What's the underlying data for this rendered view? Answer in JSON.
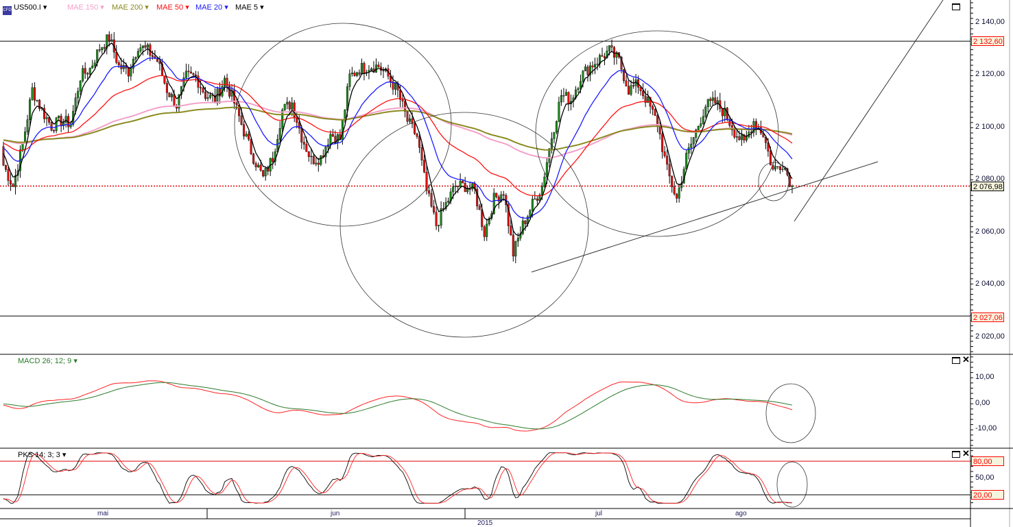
{
  "legend": {
    "symbol": "US500.I",
    "items": [
      {
        "label": "MAE 150",
        "color": "#f4a0c8"
      },
      {
        "label": "MAE 200",
        "color": "#8a8a20"
      },
      {
        "label": "MAE 50",
        "color": "#ff1010"
      },
      {
        "label": "MAE 20",
        "color": "#1a1aff"
      },
      {
        "label": "MAE 5",
        "color": "#000000"
      }
    ]
  },
  "price_axis": {
    "ticks": [
      "2 140,00",
      "2 120,00",
      "2 100,00",
      "2 080,00",
      "2 060,00",
      "2 040,00",
      "2 020,00"
    ],
    "tags": {
      "upper": "2 132,60",
      "last": "2 076,98",
      "lower": "2 027,06"
    }
  },
  "macd": {
    "label": "MACD 26; 12; 9",
    "ticks": [
      "10,00",
      "0,00",
      "-10,00"
    ]
  },
  "pks": {
    "label": "PKS 14; 3; 3",
    "ticks": [
      "80,00",
      "50,00",
      "20,00"
    ]
  },
  "time_axis": {
    "months": [
      "mai",
      "jun",
      "jul",
      "ago"
    ],
    "year": "2015"
  },
  "chart_data": {
    "type": "candlestick",
    "title": "US500.I",
    "ylim": [
      2015,
      2150
    ],
    "yticks": [
      2140,
      2120,
      2100,
      2080,
      2060,
      2040,
      2020
    ],
    "levels": {
      "upper": 2132.6,
      "lower": 2027.06,
      "last": 2076.98
    },
    "close": [
      2085,
      2077,
      2093,
      2114,
      2106,
      2100,
      2102,
      2101,
      2119,
      2122,
      2130,
      2134,
      2123,
      2121,
      2131,
      2129,
      2125,
      2114,
      2108,
      2119,
      2119,
      2112,
      2110,
      2118,
      2109,
      2098,
      2088,
      2080,
      2088,
      2106,
      2109,
      2096,
      2087,
      2088,
      2097,
      2095,
      2119,
      2122,
      2123,
      2123,
      2119,
      2113,
      2102,
      2096,
      2075,
      2062,
      2070,
      2077,
      2077,
      2075,
      2059,
      2072,
      2075,
      2051,
      2062,
      2070,
      2077,
      2096,
      2112,
      2110,
      2119,
      2123,
      2126,
      2129,
      2125,
      2114,
      2116,
      2109,
      2101,
      2083,
      2072,
      2088,
      2098,
      2108,
      2109,
      2105,
      2098,
      2093,
      2102,
      2097,
      2083,
      2086,
      2076.98
    ],
    "moving_averages": [
      {
        "name": "MAE 150",
        "period": 150,
        "color": "#f4a0c8"
      },
      {
        "name": "MAE 200",
        "period": 200,
        "color": "#8a8a20"
      },
      {
        "name": "MAE 50",
        "period": 50,
        "color": "#ff1010"
      },
      {
        "name": "MAE 20",
        "period": 20,
        "color": "#1a1aff"
      },
      {
        "name": "MAE 5",
        "period": 5,
        "color": "#000000"
      }
    ],
    "macd": {
      "fast": 12,
      "slow": 26,
      "signal": 9,
      "ylim": [
        -15,
        15
      ],
      "colors": {
        "macd": "#ff2020",
        "signal": "#2a7a2a"
      }
    },
    "stochastic": {
      "k": 14,
      "d": 3,
      "smooth": 3,
      "ylim": [
        0,
        100
      ],
      "levels": [
        80,
        20
      ]
    }
  }
}
